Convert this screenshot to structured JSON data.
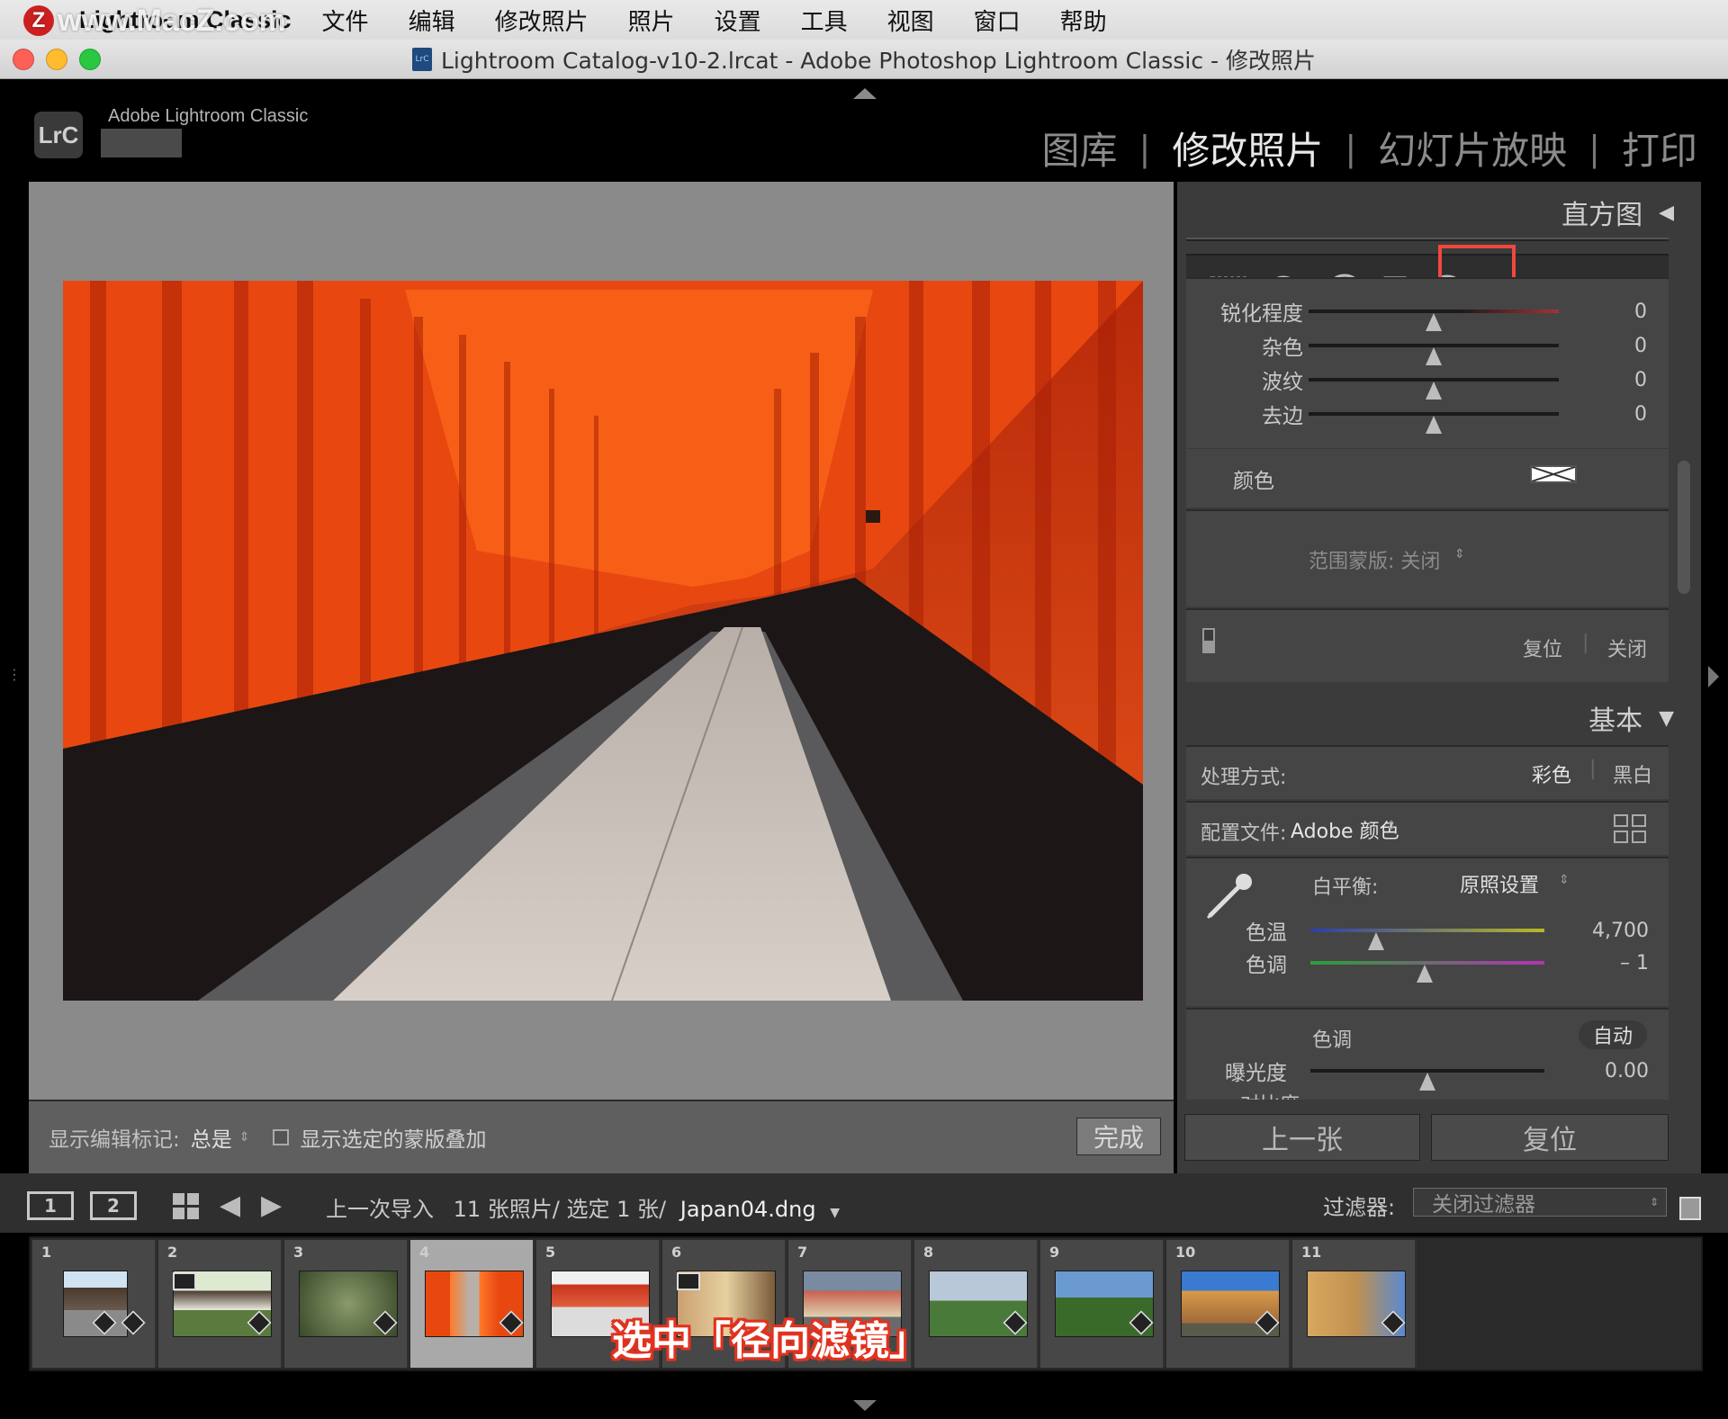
{
  "menubar": {
    "app_name": "Lightroom Classic",
    "items": [
      "文件",
      "编辑",
      "修改照片",
      "照片",
      "设置",
      "工具",
      "视图",
      "窗口",
      "帮助"
    ]
  },
  "watermark": {
    "text": "www.MacZ.com",
    "logo_letter": "Z"
  },
  "window": {
    "title": "Lightroom Catalog-v10-2.lrcat - Adobe Photoshop Lightroom Classic - 修改照片",
    "doc_icon_text": "LrC"
  },
  "identity": {
    "logo": "LrC",
    "product": "Adobe Lightroom Classic"
  },
  "modules": [
    {
      "label": "图库",
      "active": false
    },
    {
      "label": "修改照片",
      "active": true
    },
    {
      "label": "幻灯片放映",
      "active": false
    },
    {
      "label": "打印",
      "active": false
    }
  ],
  "module_separator": "|",
  "toolbar": {
    "show_edit_pins_label": "显示编辑标记:",
    "show_edit_pins_value": "总是",
    "overlay_checkbox_label": "显示选定的蒙版叠加",
    "overlay_checked": false,
    "done_label": "完成"
  },
  "right_panel": {
    "histogram_header": "直方图",
    "tools": [
      "crop-overlay-icon",
      "spot-removal-icon",
      "red-eye-icon",
      "graduated-filter-icon",
      "radial-filter-icon",
      "adjustment-brush-icon"
    ],
    "selected_tool": "radial-filter-icon",
    "filter_sliders": [
      {
        "label": "锐化程度",
        "value": "0",
        "position": 0.5
      },
      {
        "label": "杂色",
        "value": "0",
        "position": 0.5
      },
      {
        "label": "波纹",
        "value": "0",
        "position": 0.5
      },
      {
        "label": "去边",
        "value": "0",
        "position": 0.5
      }
    ],
    "color_label": "颜色",
    "range_mask_label": "范围蒙版: 关闭",
    "reset_label": "复位",
    "close_label": "关闭",
    "basic_header": "基本",
    "treatment_label": "处理方式:",
    "treatment_color": "彩色",
    "treatment_bw": "黑白",
    "profile_label": "配置文件:",
    "profile_value": "Adobe 颜色",
    "wb_label": "白平衡:",
    "wb_value": "原照设置",
    "temp_label": "色温",
    "temp_value": "4,700",
    "temp_position": 0.28,
    "tint_label": "色调",
    "tint_value": "– 1",
    "tint_position": 0.49,
    "tone_label": "色调",
    "auto_label": "自动",
    "exposure_label": "曝光度",
    "exposure_value": "0.00",
    "exposure_position": 0.5,
    "contrast_label_partial": "对比度",
    "prev_label": "上一张",
    "reset_all_label": "复位"
  },
  "filmstrip": {
    "view1": "1",
    "view2": "2",
    "source": "上一次导入",
    "count": "11 张照片/ 选定 1 张/",
    "filename": "Japan04.dng",
    "filter_label": "过滤器:",
    "filter_value": "关闭过滤器",
    "selected_index": 4,
    "thumbs": [
      "1",
      "2",
      "3",
      "4",
      "5",
      "6",
      "7",
      "8",
      "9",
      "10",
      "11"
    ]
  },
  "caption": "选中「径向滤镜」",
  "colors": {
    "accent_highlight": "#f0483c",
    "torii_red": "#e84810",
    "caption_red": "#e2321f"
  }
}
